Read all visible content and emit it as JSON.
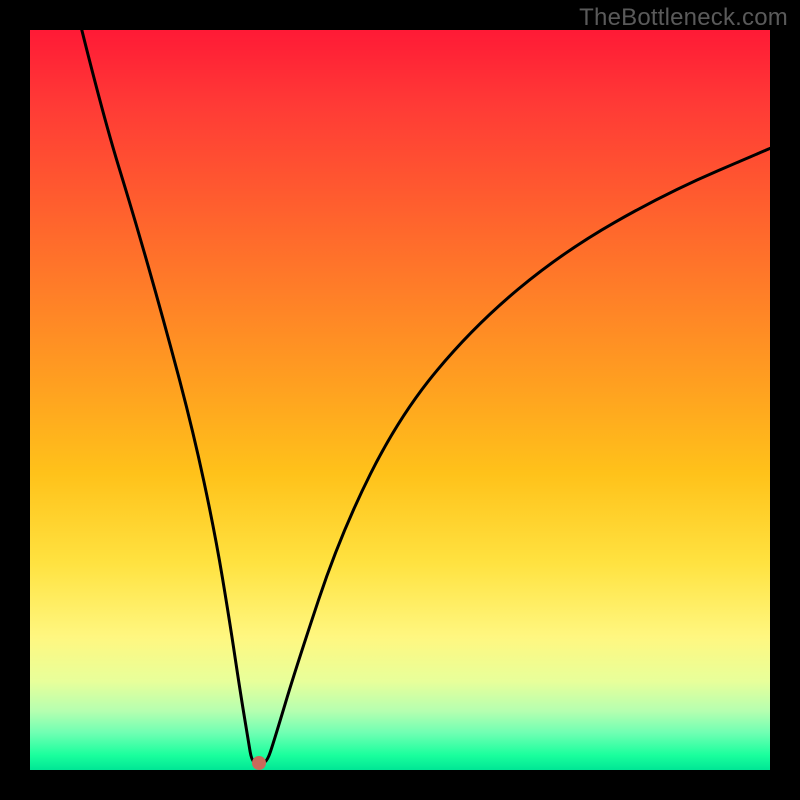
{
  "watermark": "TheBottleneck.com",
  "chart_data": {
    "type": "line",
    "title": "",
    "xlabel": "",
    "ylabel": "",
    "xlim": [
      0,
      100
    ],
    "ylim": [
      0,
      100
    ],
    "grid": false,
    "legend": false,
    "background": "heatmap-gradient red→green",
    "series": [
      {
        "name": "curve",
        "x": [
          7,
          10,
          14,
          18,
          22,
          25,
          27,
          28.5,
          29.5,
          30,
          31,
          32,
          33,
          36,
          42,
          50,
          60,
          72,
          86,
          100
        ],
        "y": [
          100,
          88,
          75,
          61,
          46,
          32,
          20,
          10,
          4,
          1,
          1,
          1,
          4,
          14,
          32,
          48,
          60,
          70,
          78,
          84
        ]
      }
    ],
    "marker": {
      "x": 31,
      "y": 1,
      "color": "#c96a5a"
    }
  },
  "colors": {
    "frame": "#000000",
    "watermark": "#5a5a5a",
    "curve": "#000000",
    "marker": "#c96a5a"
  }
}
